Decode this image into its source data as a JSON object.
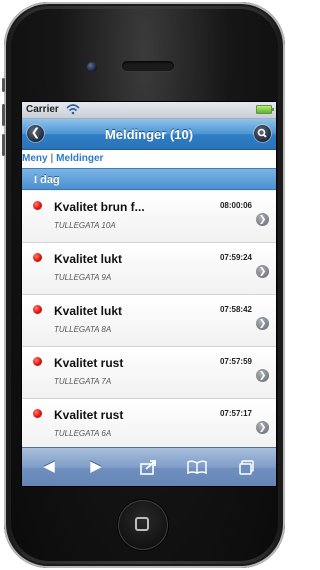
{
  "status": {
    "carrier": "Carrier"
  },
  "header": {
    "title": "Meldinger (10)"
  },
  "breadcrumb": {
    "items": [
      "Meny",
      "Meldinger"
    ],
    "separator": "|"
  },
  "section": {
    "label": "I dag"
  },
  "messages": [
    {
      "title": "Kvalitet brun f...",
      "address": "TULLEGATA 10A",
      "time": "08:00:06"
    },
    {
      "title": "Kvalitet lukt",
      "address": "TULLEGATA 9A",
      "time": "07:59:24"
    },
    {
      "title": "Kvalitet lukt",
      "address": "TULLEGATA 8A",
      "time": "07:58:42"
    },
    {
      "title": "Kvalitet rust",
      "address": "TULLEGATA 7A",
      "time": "07:57:59"
    },
    {
      "title": "Kvalitet rust",
      "address": "TULLEGATA 6A",
      "time": "07:57:17"
    }
  ],
  "icons": {
    "status_dot": "red-dot-icon",
    "chevron": "chevron-right-icon",
    "toolbar": [
      "back-arrow-icon",
      "forward-arrow-icon",
      "share-icon",
      "bookmarks-icon",
      "tabs-icon"
    ]
  },
  "colors": {
    "header_blue": "#2f7ec6",
    "link_blue": "#2f7ac5",
    "status_red": "#e2140a",
    "toolbar_blue": "#6f90bf"
  }
}
